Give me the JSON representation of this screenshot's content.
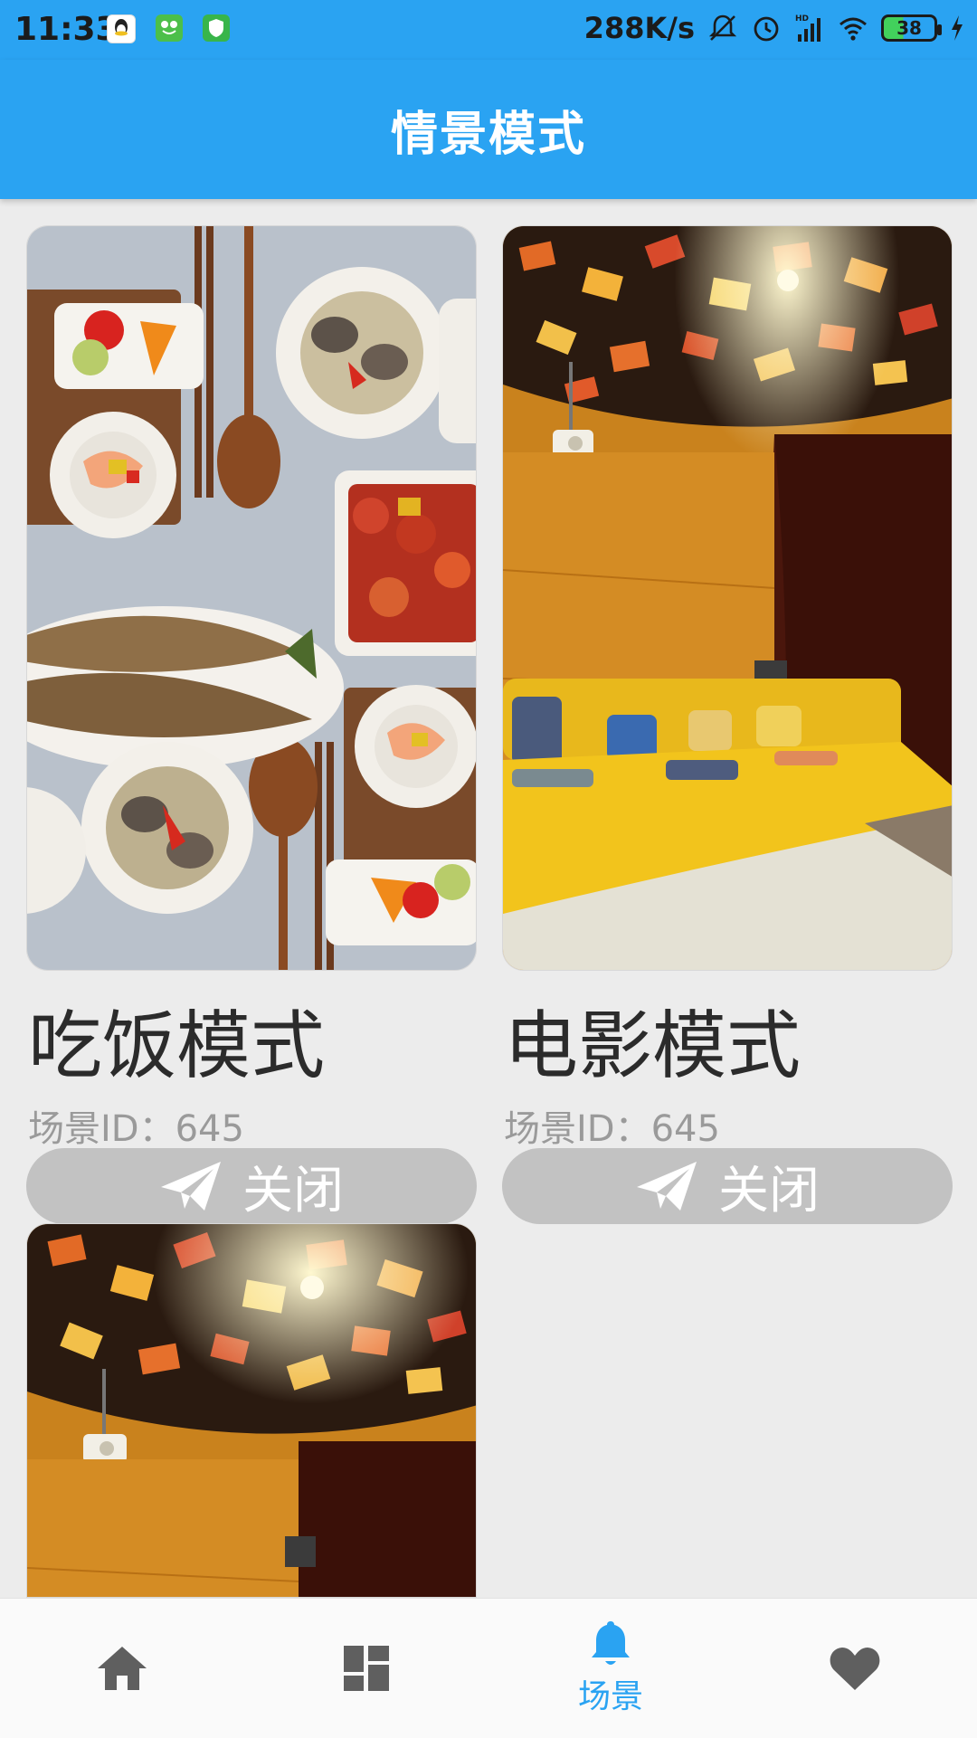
{
  "status_bar": {
    "time": "11:33",
    "speed": "288K/s",
    "battery": "38",
    "network": "HD"
  },
  "app_bar": {
    "title": "情景模式"
  },
  "scenes": [
    {
      "title": "吃饭模式",
      "id_text": "场景ID：645",
      "button_label": "关闭",
      "image": "dining-table-food-photo"
    },
    {
      "title": "电影模式",
      "id_text": "场景ID：645",
      "button_label": "关闭",
      "image": "home-theater-room-photo"
    },
    {
      "title": "",
      "id_text": "",
      "button_label": "",
      "image": "home-theater-room-photo"
    }
  ],
  "bottom_nav": {
    "items": [
      {
        "icon": "home-icon",
        "label": ""
      },
      {
        "icon": "dashboard-icon",
        "label": ""
      },
      {
        "icon": "bell-icon",
        "label": "场景",
        "active": true
      },
      {
        "icon": "heart-icon",
        "label": ""
      }
    ]
  },
  "colors": {
    "primary": "#2aa3f2",
    "background": "#ececec",
    "button": "#c2c2c2",
    "nav_inactive": "#5f5f5f"
  }
}
